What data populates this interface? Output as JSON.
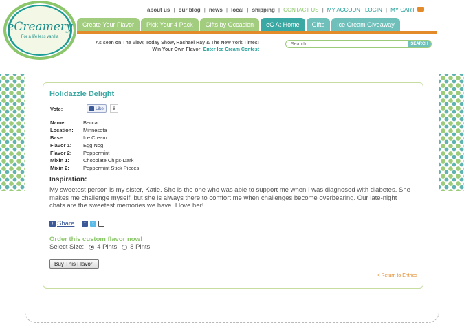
{
  "logo": {
    "name": "eCreamery",
    "tagline": "For a life less vanilla"
  },
  "toplinks": {
    "about": "about us",
    "blog": "our blog",
    "news": "news",
    "local": "local",
    "shipping": "shipping",
    "contact": "CONTACT US",
    "account": "MY ACCOUNT LOGIN",
    "cart": "MY CART"
  },
  "tabs": [
    {
      "label": "Create Your Flavor"
    },
    {
      "label": "Pick Your 4 Pack"
    },
    {
      "label": "Gifts by Occasion"
    },
    {
      "label": "eC At Home"
    },
    {
      "label": "Gifts"
    },
    {
      "label": "Ice Cream Giveaway"
    }
  ],
  "asseen": {
    "line1": "As seen on The View, Today Show, Rachael Ray & The New York Times!",
    "line2": "Win Your Own Flavor!",
    "contest_link": "Enter Ice Cream Contest"
  },
  "search": {
    "placeholder": "Search",
    "button": "SEARCH"
  },
  "flavor": {
    "title": "Holidazzle Delight",
    "vote_label": "Vote:",
    "like_label": "Like",
    "like_count": "8",
    "details": [
      {
        "key": "Name:",
        "value": "Becca"
      },
      {
        "key": "Location:",
        "value": "Minnesota"
      },
      {
        "key": "Base:",
        "value": "Ice Cream"
      },
      {
        "key": "Flavor 1:",
        "value": "Egg Nog"
      },
      {
        "key": "Flavor 2:",
        "value": "Peppermint"
      },
      {
        "key": "Mixin 1:",
        "value": "Chocolate Chips-Dark"
      },
      {
        "key": "Mixin 2:",
        "value": "Peppermint Stick Pieces"
      }
    ],
    "inspiration_label": "Inspiration:",
    "inspiration_text": "My sweetest person is my sister, Katie. She is the one who was able to support me when I was diagnosed with diabetes. She makes me challenge myself, but she is always there to comfort me when challenges become overbearing. Our late-night chats are the sweetest memories we have. I love her!",
    "share_label": "Share",
    "order_label": "Order this custom flavor now!",
    "size_label": "Select Size:",
    "size_options": [
      "4 Pints",
      "8 Pints"
    ],
    "selected_size": "4 Pints",
    "buy_label": "Buy This Flavor!",
    "return_label": "< Return to Entries"
  },
  "colors": {
    "accent_teal": "#3aa8a3",
    "accent_green": "#8cc66a",
    "accent_orange": "#e38b2b"
  }
}
